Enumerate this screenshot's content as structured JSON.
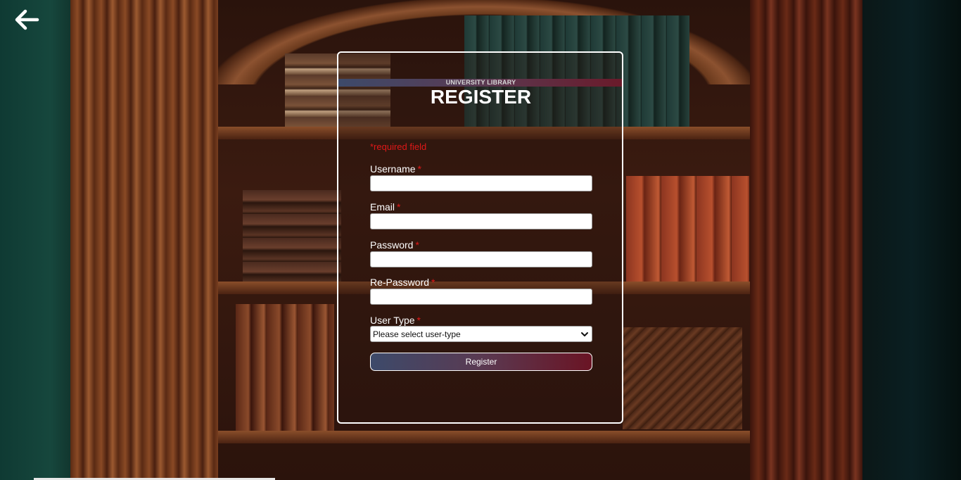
{
  "header": {
    "back_icon": "arrow-left-icon"
  },
  "form": {
    "brand": "UNIVERSITY LIBRARY",
    "title": "REGISTER",
    "required_note": "*required field",
    "fields": [
      {
        "label": "Username",
        "required_mark": "*",
        "value": ""
      },
      {
        "label": "Email",
        "required_mark": "*",
        "value": ""
      },
      {
        "label": "Password",
        "required_mark": "*",
        "value": ""
      },
      {
        "label": "Re-Password",
        "required_mark": "*",
        "value": ""
      }
    ],
    "user_type": {
      "label": "User Type",
      "required_mark": "*",
      "selected": "Please select user-type",
      "icon": "chevron-down-icon"
    },
    "submit_label": "Register"
  },
  "colors": {
    "required": "#e01818",
    "gradient_start": "#3d4a6a",
    "gradient_end": "#6a1424"
  }
}
